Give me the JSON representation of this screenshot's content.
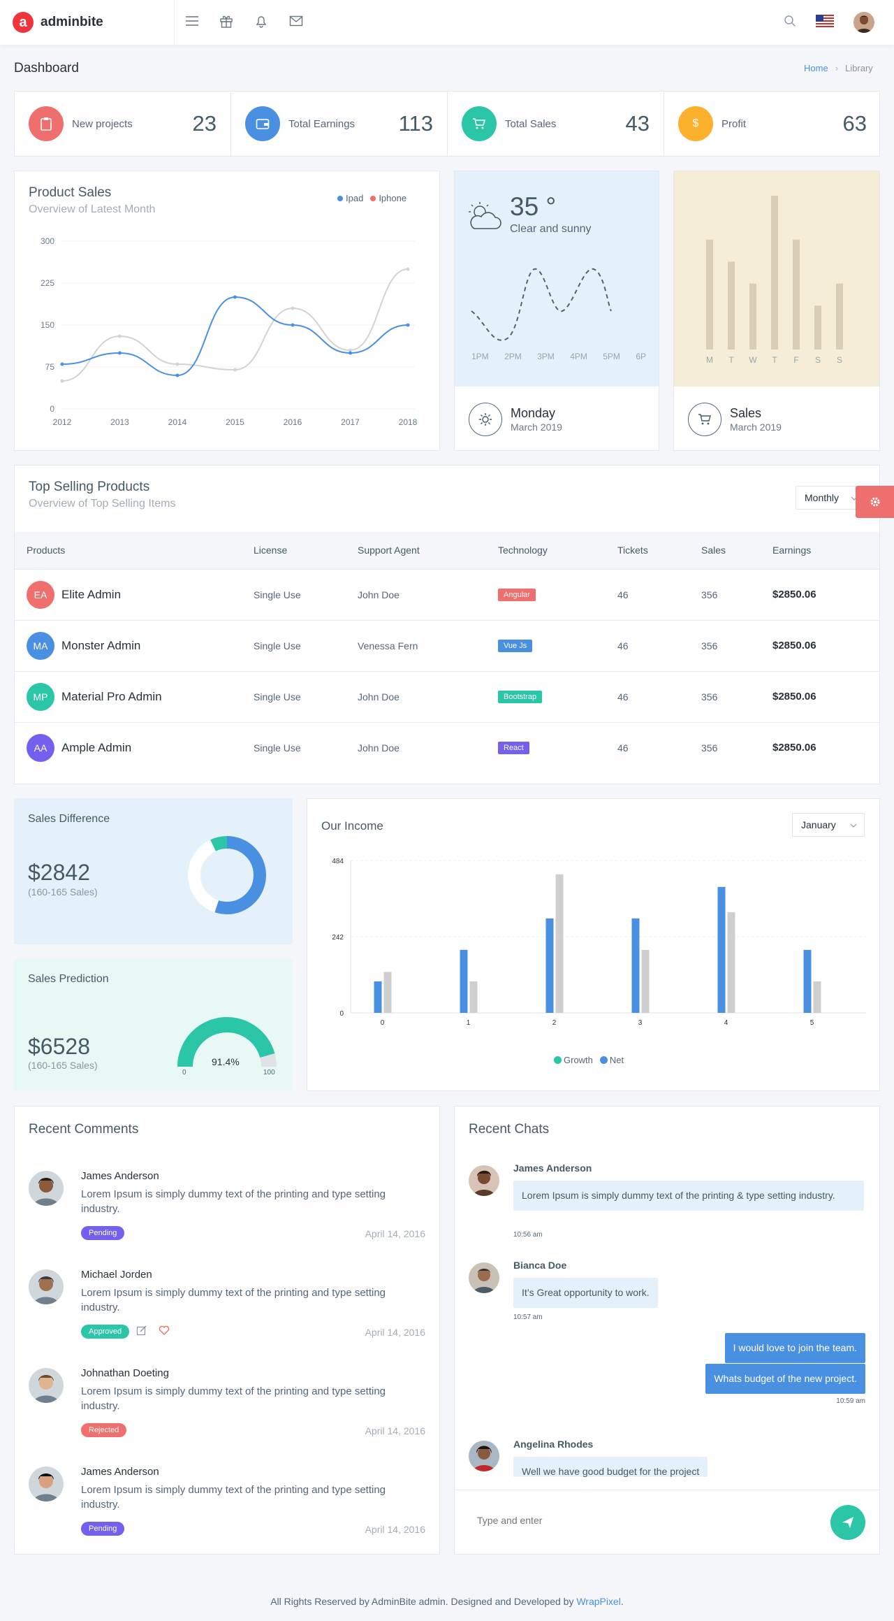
{
  "brand": {
    "name": "adminbite",
    "mark": "a"
  },
  "page": {
    "title": "Dashboard",
    "breadcrumb": [
      "Home",
      "Library"
    ]
  },
  "stats": [
    {
      "label": "New projects",
      "value": "23",
      "color": "#ef6e6e",
      "icon": "clipboard-icon"
    },
    {
      "label": "Total Earnings",
      "value": "113",
      "color": "#4a90e2",
      "icon": "wallet-icon"
    },
    {
      "label": "Total Sales",
      "value": "43",
      "color": "#2bc5a8",
      "icon": "cart-icon"
    },
    {
      "label": "Profit",
      "value": "63",
      "color": "#fbb12c",
      "icon": "dollar-icon",
      "symbol": "$"
    }
  ],
  "product_sales": {
    "title": "Product Sales",
    "subtitle": "Overview of Latest Month",
    "chart_data": {
      "type": "line",
      "x": [
        "2012",
        "2013",
        "2014",
        "2015",
        "2016",
        "2017",
        "2018"
      ],
      "yticks": [
        "0",
        "75",
        "150",
        "225",
        "300"
      ],
      "ylim": [
        0,
        300
      ],
      "series": [
        {
          "name": "Ipad",
          "color": "#4a90e2",
          "values": [
            80,
            100,
            60,
            200,
            150,
            100,
            150
          ]
        },
        {
          "name": "Iphone",
          "color": "#cfd4d8",
          "values": [
            50,
            130,
            80,
            70,
            180,
            105,
            250
          ]
        }
      ]
    }
  },
  "weather": {
    "temp": "35 °",
    "desc": "Clear and sunny",
    "times": [
      "1PM",
      "2PM",
      "3PM",
      "4PM",
      "5PM",
      "6P"
    ],
    "day": "Monday",
    "date": "March 2019"
  },
  "sales_week": {
    "days": [
      "M",
      "T",
      "W",
      "T",
      "F",
      "S",
      "S"
    ],
    "values": [
      50,
      40,
      30,
      70,
      50,
      20,
      30
    ],
    "title": "Sales",
    "date": "March 2019"
  },
  "top_selling": {
    "title": "Top Selling Products",
    "subtitle": "Overview of Top Selling Items",
    "filter": "Monthly",
    "columns": [
      "Products",
      "License",
      "Support Agent",
      "Technology",
      "Tickets",
      "Sales",
      "Earnings"
    ],
    "rows": [
      {
        "initials": "EA",
        "avatar_color": "#ef6e6e",
        "product": "Elite Admin",
        "license": "Single Use",
        "agent": "John Doe",
        "tech": "Angular",
        "tech_color": "#ef6e6e",
        "tickets": "46",
        "sales": "356",
        "earnings": "$2850.06"
      },
      {
        "initials": "MA",
        "avatar_color": "#4a90e2",
        "product": "Monster Admin",
        "license": "Single Use",
        "agent": "Venessa Fern",
        "tech": "Vue Js",
        "tech_color": "#4a90e2",
        "tickets": "46",
        "sales": "356",
        "earnings": "$2850.06"
      },
      {
        "initials": "MP",
        "avatar_color": "#2bc5a8",
        "product": "Material Pro Admin",
        "license": "Single Use",
        "agent": "John Doe",
        "tech": "Bootstrap",
        "tech_color": "#2bc5a8",
        "tickets": "46",
        "sales": "356",
        "earnings": "$2850.06"
      },
      {
        "initials": "AA",
        "avatar_color": "#7460ee",
        "product": "Ample Admin",
        "license": "Single Use",
        "agent": "John Doe",
        "tech": "React",
        "tech_color": "#7460ee",
        "tickets": "46",
        "sales": "356",
        "earnings": "$2850.06"
      }
    ]
  },
  "sales_difference": {
    "title": "Sales Difference",
    "value": "$2842",
    "sub": "(160-165 Sales)",
    "fraction": 0.55
  },
  "sales_prediction": {
    "title": "Sales Prediction",
    "value": "$6528",
    "sub": "(160-165 Sales)",
    "gauge_label": "91.4%",
    "gauge_value": 91.4,
    "min": "0",
    "max": "100"
  },
  "income": {
    "title": "Our Income",
    "filter": "January",
    "chart_data": {
      "type": "bar",
      "categories": [
        "0",
        "1",
        "2",
        "3",
        "4",
        "5"
      ],
      "yticks": [
        "0",
        "242",
        "484"
      ],
      "ylim": [
        0,
        484
      ],
      "series": [
        {
          "name": "Growth",
          "color": "#4a90e2",
          "values": [
            100,
            200,
            300,
            300,
            400,
            200
          ]
        },
        {
          "name": "Net",
          "color": "#cfcfcf",
          "values": [
            130,
            100,
            440,
            200,
            320,
            100
          ]
        }
      ],
      "legend": [
        {
          "name": "Growth",
          "color": "#2bc5a8"
        },
        {
          "name": "Net",
          "color": "#4a90e2"
        }
      ]
    }
  },
  "comments": {
    "title": "Recent Comments",
    "items": [
      {
        "name": "James Anderson",
        "text": "Lorem Ipsum is simply dummy text of the printing and type setting industry.",
        "status": "Pending",
        "status_color": "#7460ee",
        "date": "April 14, 2016",
        "actions": false,
        "skin": "#8d5a3b",
        "hair": "#2b1d16"
      },
      {
        "name": "Michael Jorden",
        "text": "Lorem Ipsum is simply dummy text of the printing and type setting industry.",
        "status": "Approved",
        "status_color": "#2bc5a8",
        "date": "April 14, 2016",
        "actions": true,
        "skin": "#a0704f",
        "hair": "#3b3b3b"
      },
      {
        "name": "Johnathan Doeting",
        "text": "Lorem Ipsum is simply dummy text of the printing and type setting industry.",
        "status": "Rejected",
        "status_color": "#ef6e6e",
        "date": "April 14, 2016",
        "actions": false,
        "skin": "#e0b48f",
        "hair": "#6b4a2f"
      },
      {
        "name": "James Anderson",
        "text": "Lorem Ipsum is simply dummy text of the printing and type setting industry.",
        "status": "Pending",
        "status_color": "#7460ee",
        "date": "April 14, 2016",
        "actions": false,
        "skin": "#d9a27f",
        "hair": "#111111"
      }
    ]
  },
  "chats": {
    "title": "Recent Chats",
    "placeholder": "Type and enter",
    "messages": [
      {
        "name": "James Anderson",
        "text": "Lorem Ipsum is simply dummy text of the printing & type setting industry.",
        "time": "10:56 am"
      },
      {
        "name": "Bianca Doe",
        "text": "It’s Great opportunity to work.",
        "time": "10:57 am"
      },
      {
        "out1": "I would love to join the team.",
        "out2": "Whats budget of the new project.",
        "time": "10:59 am"
      },
      {
        "name": "Angelina Rhodes",
        "text": "Well we have good budget for the project"
      }
    ]
  },
  "footer": {
    "text": "All Rights Reserved by AdminBite admin. Designed and Developed by ",
    "link": "WrapPixel",
    "dot": "."
  }
}
